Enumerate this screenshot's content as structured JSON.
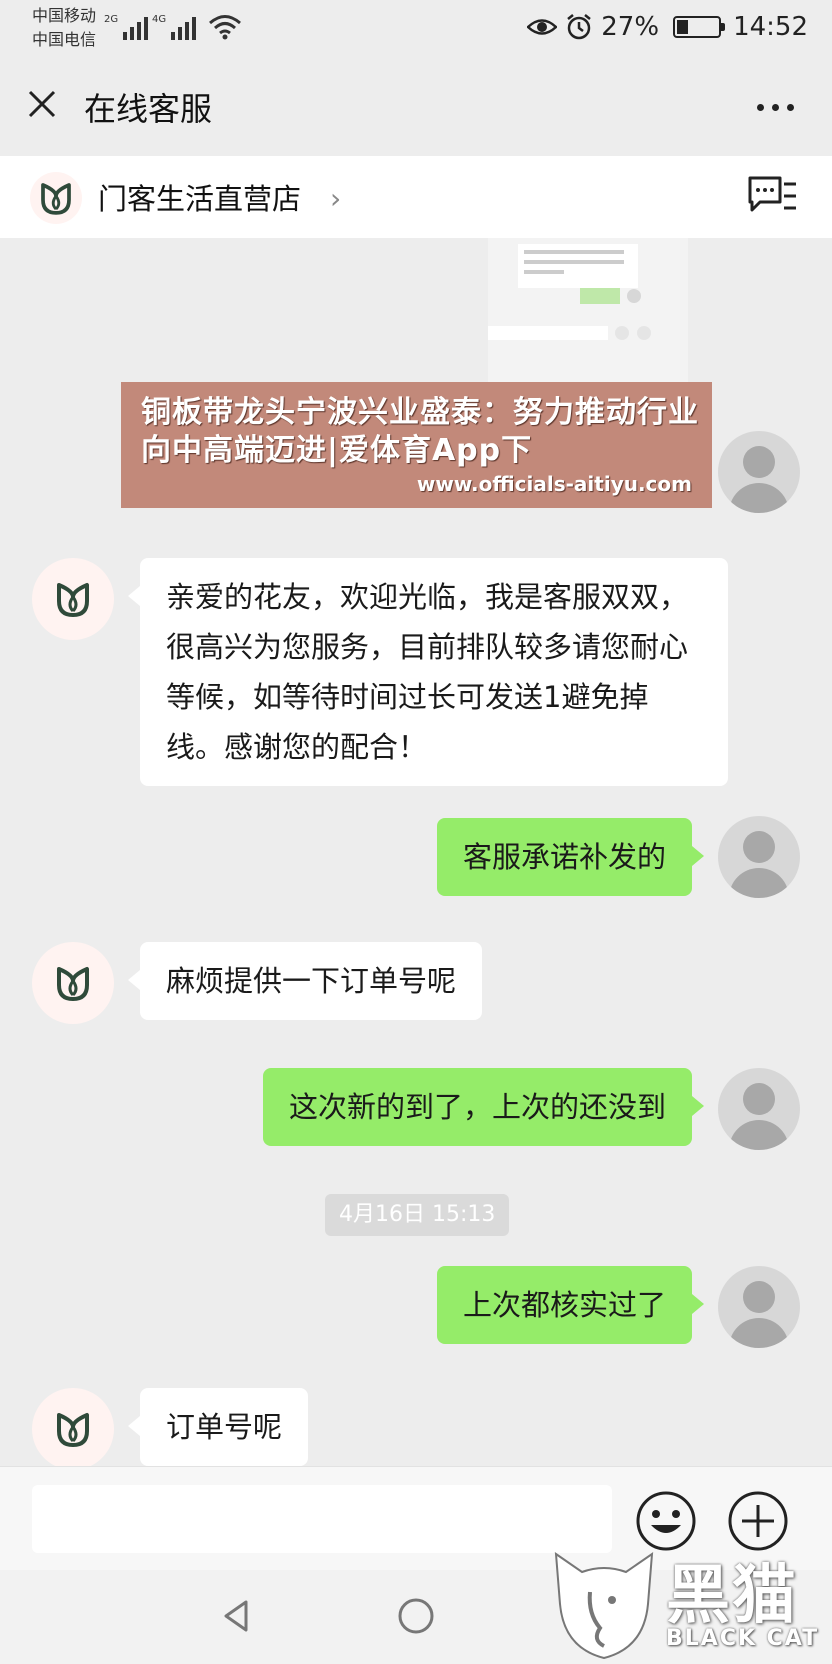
{
  "status_bar": {
    "carrier_1": "中国移动",
    "carrier_2": "中国电信",
    "net_1": "2G",
    "net_2": "4G",
    "battery_text": "27%",
    "battery_level": 0.27,
    "time": "14:52"
  },
  "header": {
    "title": "在线客服"
  },
  "shop": {
    "name": "门客生活直营店"
  },
  "banner": {
    "headline": "铜板带龙头宁波兴业盛泰：努力推动行业向中高端迈进|爱体育App下",
    "url": "www.officials-aitiyu.com"
  },
  "messages": [
    {
      "side": "left",
      "text": "亲爱的花友，欢迎光临，我是客服双双，很高兴为您服务，目前排队较多请您耐心等候，如等待时间过长可发送1避免掉线。感谢您的配合！"
    },
    {
      "side": "right",
      "text": "客服承诺补发的"
    },
    {
      "side": "left",
      "text": "麻烦提供一下订单号呢"
    },
    {
      "side": "right",
      "text": "这次新的到了，上次的还没到"
    },
    {
      "side": "right",
      "text": "上次都核实过了"
    },
    {
      "side": "left",
      "text": "订单号呢"
    }
  ],
  "timestamp": "4月16日 15:13",
  "watermark": {
    "cn": "黑猫",
    "en": "BLACK CAT"
  },
  "colors": {
    "background": "#ededed",
    "bubble_self": "#95ec69",
    "bubble_other": "#ffffff",
    "logo_green": "#2f4a3a",
    "banner_bg": "#c2897a"
  },
  "icons": {
    "close": "close-icon",
    "more": "more-icon",
    "shop_logo": "tulip-logo-icon",
    "chat_list": "chat-list-icon",
    "emoji": "emoji-icon",
    "plus": "plus-icon"
  }
}
